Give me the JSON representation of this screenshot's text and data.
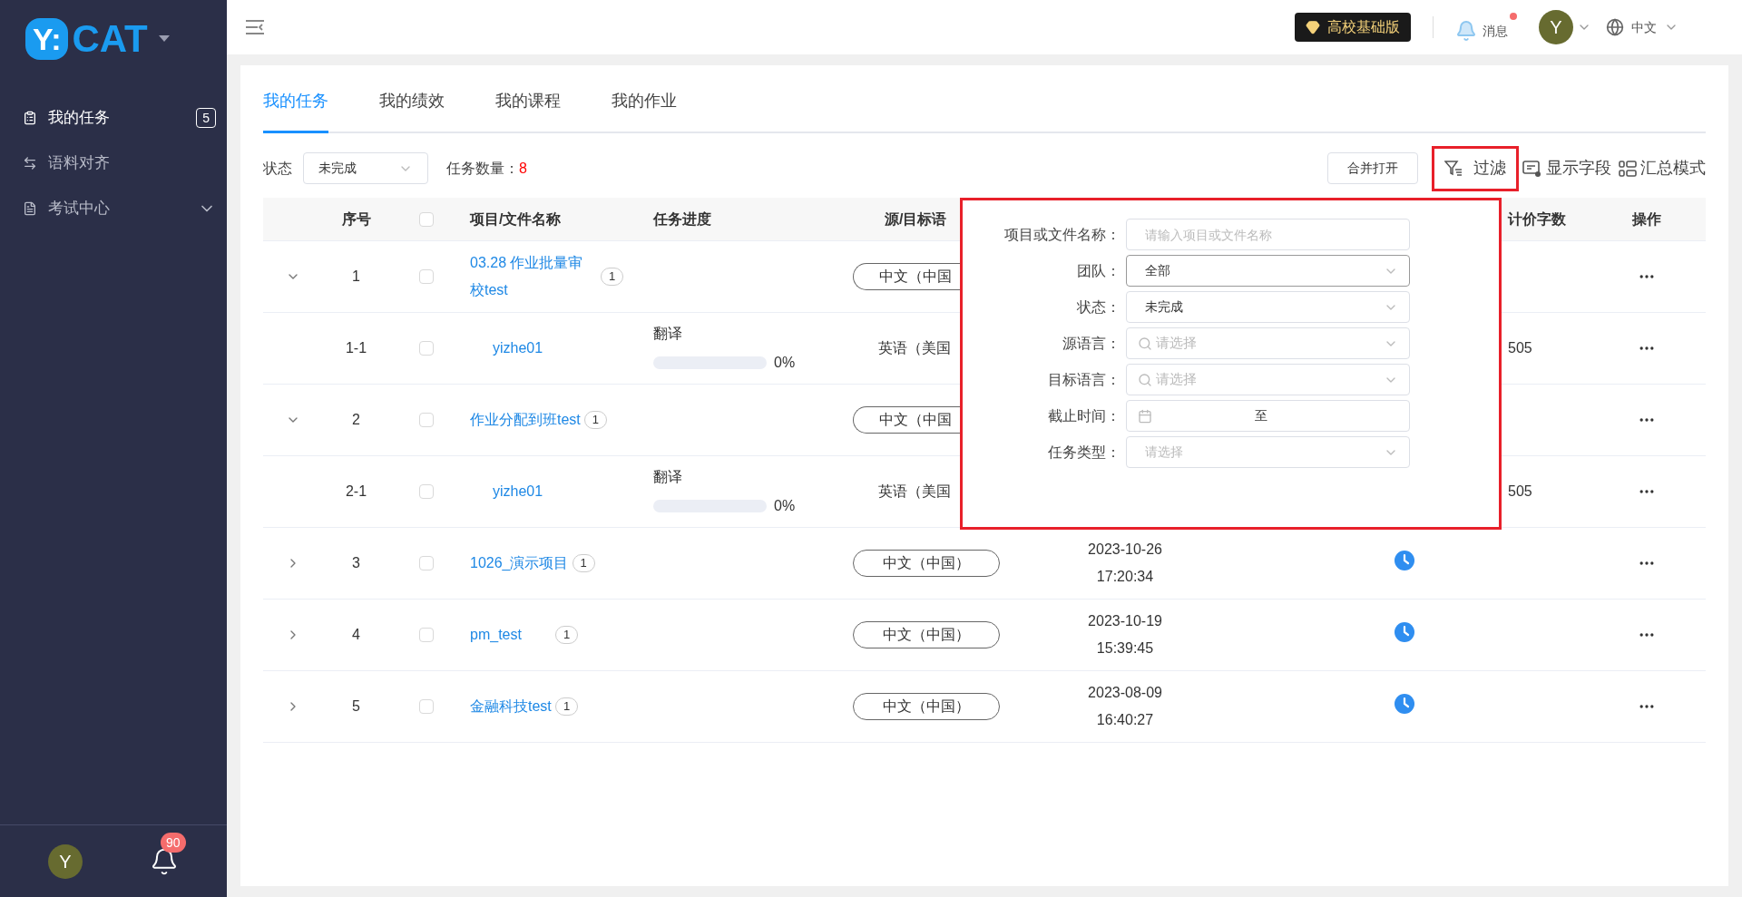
{
  "sidebar": {
    "logo": {
      "mark": "Y:",
      "text": "CAT"
    },
    "items": [
      {
        "label": "我的任务",
        "selected": true,
        "badge": "5",
        "kind": "task"
      },
      {
        "label": "语料对齐",
        "selected": false,
        "kind": "align"
      },
      {
        "label": "考试中心",
        "selected": false,
        "kind": "exam",
        "expandable": true
      }
    ],
    "user_initial": "Y",
    "notification_count": "90"
  },
  "topbar": {
    "edition": "高校基础版",
    "messages": "消息",
    "unread": true,
    "avatar": "Y",
    "language": "中文"
  },
  "tabs": [
    {
      "label": "我的任务",
      "selected": true
    },
    {
      "label": "我的绩效",
      "selected": false
    },
    {
      "label": "我的课程",
      "selected": false
    },
    {
      "label": "我的作业",
      "selected": false
    }
  ],
  "toolbar": {
    "status_label": "状态",
    "status_value": "未完成",
    "count_label": "任务数量：",
    "count": "8",
    "merge_button": "合并打开",
    "filter": "过滤",
    "filter_highlighted": true,
    "show_fields": "显示字段",
    "summary": "汇总模式"
  },
  "table": {
    "select_all_checked": false,
    "columns": [
      "序号",
      "项目/文件名称",
      "任务进度",
      "源/目标语",
      "计价字数",
      "操作"
    ],
    "rows": [
      {
        "kind": "project",
        "expanded": true,
        "index": "1",
        "checked": false,
        "name": "03.28 作业批量审校test",
        "count": "1",
        "lang": "中文（中国",
        "lang_cut": true
      },
      {
        "kind": "file",
        "index": "1-1",
        "checked": false,
        "name": "yizhe01",
        "task_type": "翻译",
        "level": 0,
        "percent": "0%",
        "lang": "英语（美国",
        "words": "505"
      },
      {
        "kind": "project",
        "expanded": true,
        "index": "2",
        "checked": false,
        "name": "作业分配到班test",
        "count": "1",
        "lang": "中文（中国",
        "lang_cut": true
      },
      {
        "kind": "file",
        "index": "2-1",
        "checked": false,
        "name": "yizhe01",
        "task_type": "翻译",
        "level": 0,
        "percent": "0%",
        "lang": "英语（美国",
        "words": "505"
      },
      {
        "kind": "project",
        "expanded": false,
        "index": "3",
        "checked": false,
        "name": "1026_演示项目",
        "count": "1",
        "lang": "中文（中国）",
        "lang_cut": false,
        "date": "2023-10-26",
        "time": "17:20:34",
        "pending": true
      },
      {
        "kind": "project",
        "expanded": false,
        "index": "4",
        "checked": false,
        "name": "pm_test",
        "count": "1",
        "lang": "中文（中国）",
        "lang_cut": false,
        "date": "2023-10-19",
        "time": "15:39:45",
        "pending": true
      },
      {
        "kind": "project",
        "expanded": false,
        "index": "5",
        "checked": false,
        "name": "金融科技test",
        "count": "1",
        "lang": "中文（中国）",
        "lang_cut": false,
        "date": "2023-08-09",
        "time": "16:40:27",
        "pending": true
      }
    ]
  },
  "filter_panel": {
    "fields": [
      {
        "kind": "text",
        "label": "项目或文件名称：",
        "placeholder": "请输入项目或文件名称"
      },
      {
        "kind": "select",
        "label": "团队：",
        "value": "全部",
        "focused": true
      },
      {
        "kind": "select",
        "label": "状态：",
        "value": "未完成",
        "focused": false
      },
      {
        "kind": "search",
        "label": "源语言：",
        "placeholder": "请选择"
      },
      {
        "kind": "search",
        "label": "目标语言：",
        "placeholder": "请选择"
      },
      {
        "kind": "date",
        "label": "截止时间：",
        "separator": "至"
      },
      {
        "kind": "select",
        "label": "任务类型：",
        "placeholder": "请选择",
        "focused": false
      }
    ]
  }
}
